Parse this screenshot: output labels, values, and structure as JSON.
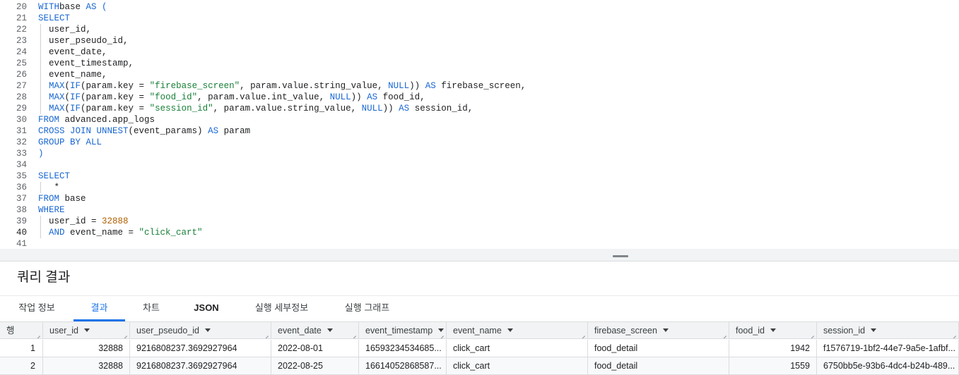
{
  "editor": {
    "lines": [
      {
        "n": "20",
        "segs": [
          [
            "kw",
            "WITH"
          ],
          [
            "",
            "base "
          ],
          [
            "kw",
            "AS"
          ],
          [
            "kw",
            " ("
          ]
        ]
      },
      {
        "n": "21",
        "segs": [
          [
            "kw",
            "SELECT"
          ]
        ]
      },
      {
        "n": "22",
        "guide": true,
        "segs": [
          [
            "",
            "  user_id,"
          ]
        ]
      },
      {
        "n": "23",
        "guide": true,
        "segs": [
          [
            "",
            "  user_pseudo_id,"
          ]
        ]
      },
      {
        "n": "24",
        "guide": true,
        "segs": [
          [
            "",
            "  event_date,"
          ]
        ]
      },
      {
        "n": "25",
        "guide": true,
        "segs": [
          [
            "",
            "  event_timestamp,"
          ]
        ]
      },
      {
        "n": "26",
        "guide": true,
        "segs": [
          [
            "",
            "  event_name,"
          ]
        ]
      },
      {
        "n": "27",
        "guide": true,
        "segs": [
          [
            "kw",
            "  MAX"
          ],
          [
            "",
            "("
          ],
          [
            "kw",
            "IF"
          ],
          [
            "",
            "(param.key = "
          ],
          [
            "str",
            "\"firebase_screen\""
          ],
          [
            "",
            ", param.value.string_value, "
          ],
          [
            "kw",
            "NULL"
          ],
          [
            "",
            "))"
          ],
          [
            "kw",
            " AS"
          ],
          [
            "",
            " firebase_screen,"
          ]
        ]
      },
      {
        "n": "28",
        "guide": true,
        "segs": [
          [
            "kw",
            "  MAX"
          ],
          [
            "",
            "("
          ],
          [
            "kw",
            "IF"
          ],
          [
            "",
            "(param.key = "
          ],
          [
            "str",
            "\"food_id\""
          ],
          [
            "",
            ", param.value.int_value, "
          ],
          [
            "kw",
            "NULL"
          ],
          [
            "",
            "))"
          ],
          [
            "kw",
            " AS"
          ],
          [
            "",
            " food_id,"
          ]
        ]
      },
      {
        "n": "29",
        "guide": true,
        "segs": [
          [
            "kw",
            "  MAX"
          ],
          [
            "",
            "("
          ],
          [
            "kw",
            "IF"
          ],
          [
            "",
            "(param.key = "
          ],
          [
            "str",
            "\"session_id\""
          ],
          [
            "",
            ", param.value.string_value, "
          ],
          [
            "kw",
            "NULL"
          ],
          [
            "",
            "))"
          ],
          [
            "kw",
            " AS"
          ],
          [
            "",
            " session_id,"
          ]
        ]
      },
      {
        "n": "30",
        "segs": [
          [
            "kw",
            "FROM"
          ],
          [
            "",
            " advanced.app_logs"
          ]
        ]
      },
      {
        "n": "31",
        "segs": [
          [
            "kw",
            "CROSS JOIN UNNEST"
          ],
          [
            "",
            "(event_params) "
          ],
          [
            "kw",
            "AS"
          ],
          [
            "",
            " param"
          ]
        ]
      },
      {
        "n": "32",
        "segs": [
          [
            "kw",
            "GROUP BY ALL"
          ]
        ]
      },
      {
        "n": "33",
        "segs": [
          [
            "kw",
            ")"
          ]
        ]
      },
      {
        "n": "34",
        "segs": []
      },
      {
        "n": "35",
        "segs": [
          [
            "kw",
            "SELECT"
          ]
        ]
      },
      {
        "n": "36",
        "guide": true,
        "segs": [
          [
            "",
            "   *"
          ]
        ]
      },
      {
        "n": "37",
        "segs": [
          [
            "kw",
            "FROM"
          ],
          [
            "",
            " base"
          ]
        ]
      },
      {
        "n": "38",
        "segs": [
          [
            "kw",
            "WHERE"
          ]
        ]
      },
      {
        "n": "39",
        "guide": true,
        "segs": [
          [
            "",
            "  user_id = "
          ],
          [
            "num",
            "32888"
          ]
        ]
      },
      {
        "n": "40",
        "guide": true,
        "active": true,
        "segs": [
          [
            "kw",
            "  AND"
          ],
          [
            "",
            " event_name = "
          ],
          [
            "str",
            "\"click_cart\""
          ]
        ]
      },
      {
        "n": "41",
        "segs": []
      }
    ]
  },
  "results": {
    "title": "쿼리 결과",
    "tabs": [
      {
        "label": "작업 정보",
        "active": false,
        "bold": false
      },
      {
        "label": "결과",
        "active": true,
        "bold": false
      },
      {
        "label": "차트",
        "active": false,
        "bold": false
      },
      {
        "label": "JSON",
        "active": false,
        "bold": true
      },
      {
        "label": "실행 세부정보",
        "active": false,
        "bold": false
      },
      {
        "label": "실행 그래프",
        "active": false,
        "bold": false
      }
    ],
    "row_header": "행",
    "columns": [
      "user_id",
      "user_pseudo_id",
      "event_date",
      "event_timestamp",
      "event_name",
      "firebase_screen",
      "food_id",
      "session_id"
    ],
    "rows": [
      {
        "n": "1",
        "values": [
          "32888",
          "9216808237.3692927964",
          "2022-08-01",
          "16593234534685...",
          "click_cart",
          "food_detail",
          "1942",
          "f1576719-1bf2-44e7-9a5e-1afbf..."
        ]
      },
      {
        "n": "2",
        "values": [
          "32888",
          "9216808237.3692927964",
          "2022-08-25",
          "16614052868587...",
          "click_cart",
          "food_detail",
          "1559",
          "6750bb5e-93b6-4dc4-b24b-489..."
        ]
      }
    ]
  }
}
